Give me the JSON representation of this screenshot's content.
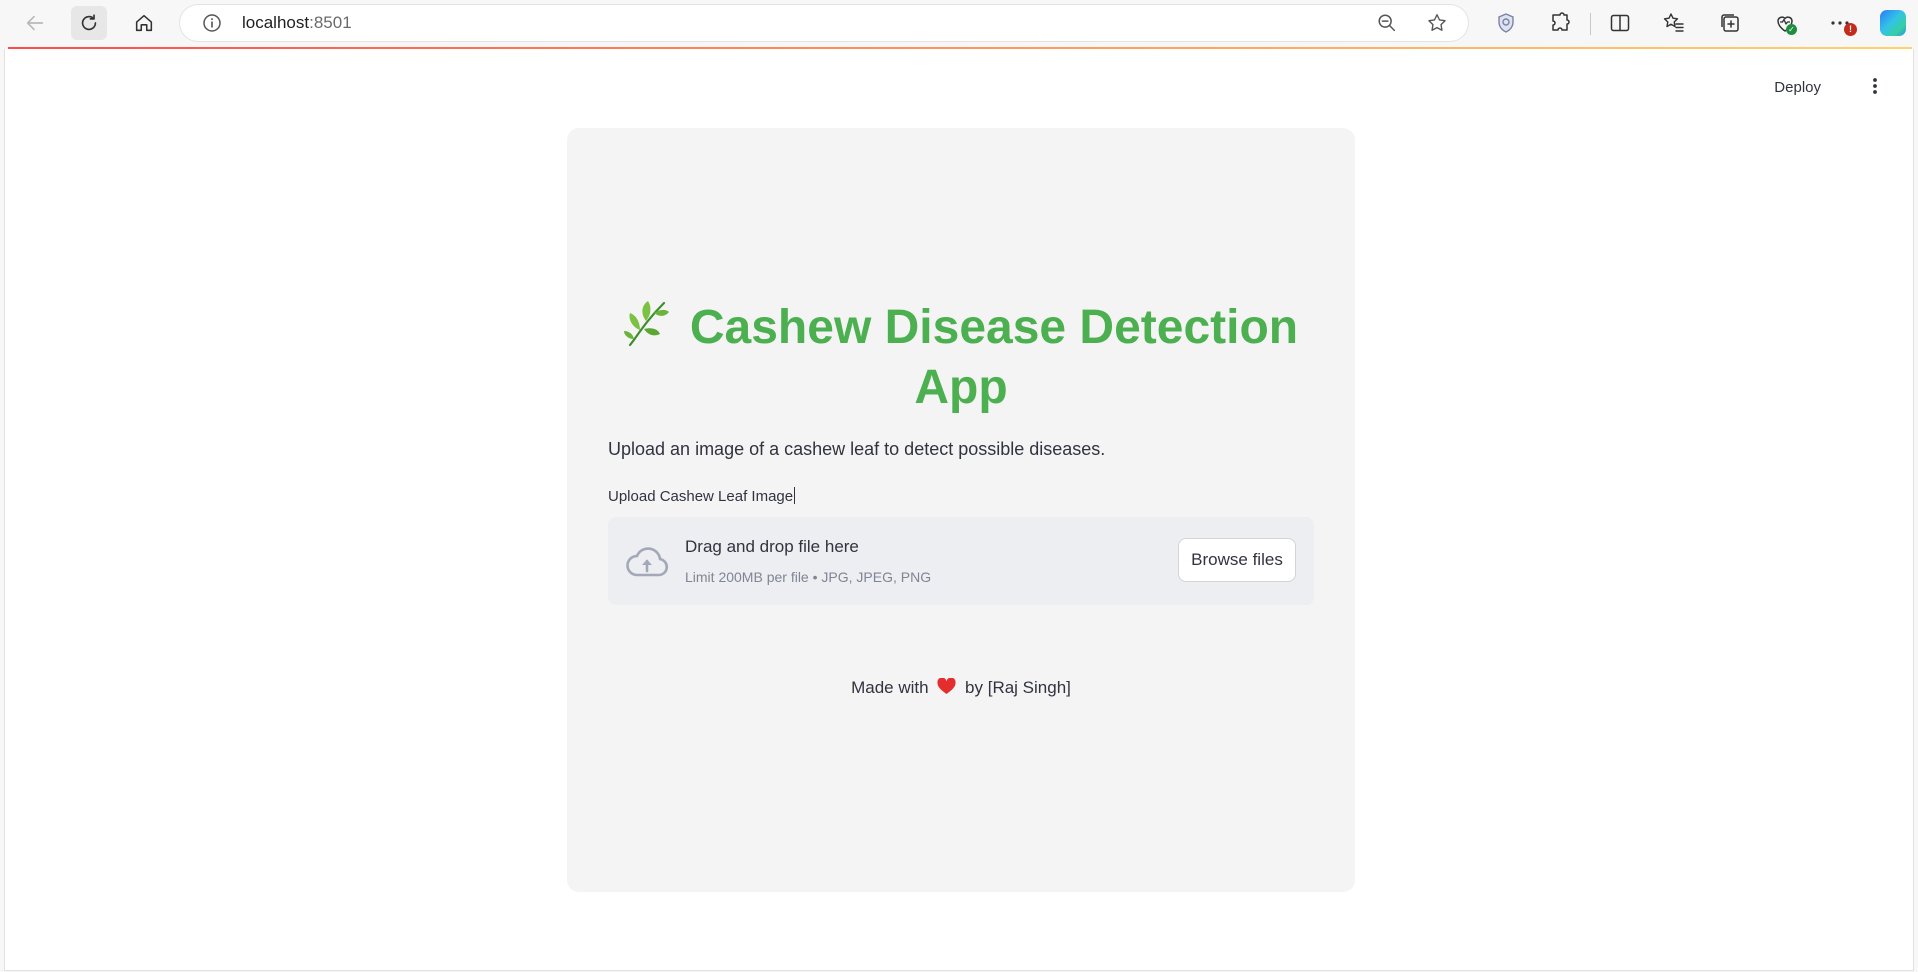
{
  "browser": {
    "url_host": "localhost",
    "url_port": ":8501",
    "icons": {
      "back": "arrow-left-icon",
      "refresh": "refresh-icon",
      "home": "home-icon",
      "info": "info-icon",
      "zoom": "zoom-out-icon",
      "favorite": "star-icon",
      "toolbar": [
        "shield-icon",
        "extensions-icon",
        "split-screen-icon",
        "favorites-icon",
        "collections-icon",
        "browser-essentials-icon",
        "more-icon",
        "copilot-icon"
      ]
    }
  },
  "header": {
    "deploy_label": "Deploy",
    "menu_icon": "kebab-menu-icon"
  },
  "main": {
    "title_icon": "🌿",
    "title_line1": "Cashew Disease Detection",
    "title_line2": "App",
    "description": "Upload an image of a cashew leaf to detect possible diseases.",
    "uploader": {
      "label": "Upload Cashew Leaf Image",
      "drop_title": "Drag and drop file here",
      "drop_subtitle": "Limit 200MB per file • JPG, JPEG, PNG",
      "browse_label": "Browse files"
    },
    "footer": {
      "prefix": "Made with",
      "suffix": "by [Raj Singh]"
    }
  },
  "colors": {
    "title": "#4caf50",
    "accent": "#ff4b4b",
    "card_bg": "#f4f4f5",
    "dropzone_bg": "#eceef1"
  }
}
